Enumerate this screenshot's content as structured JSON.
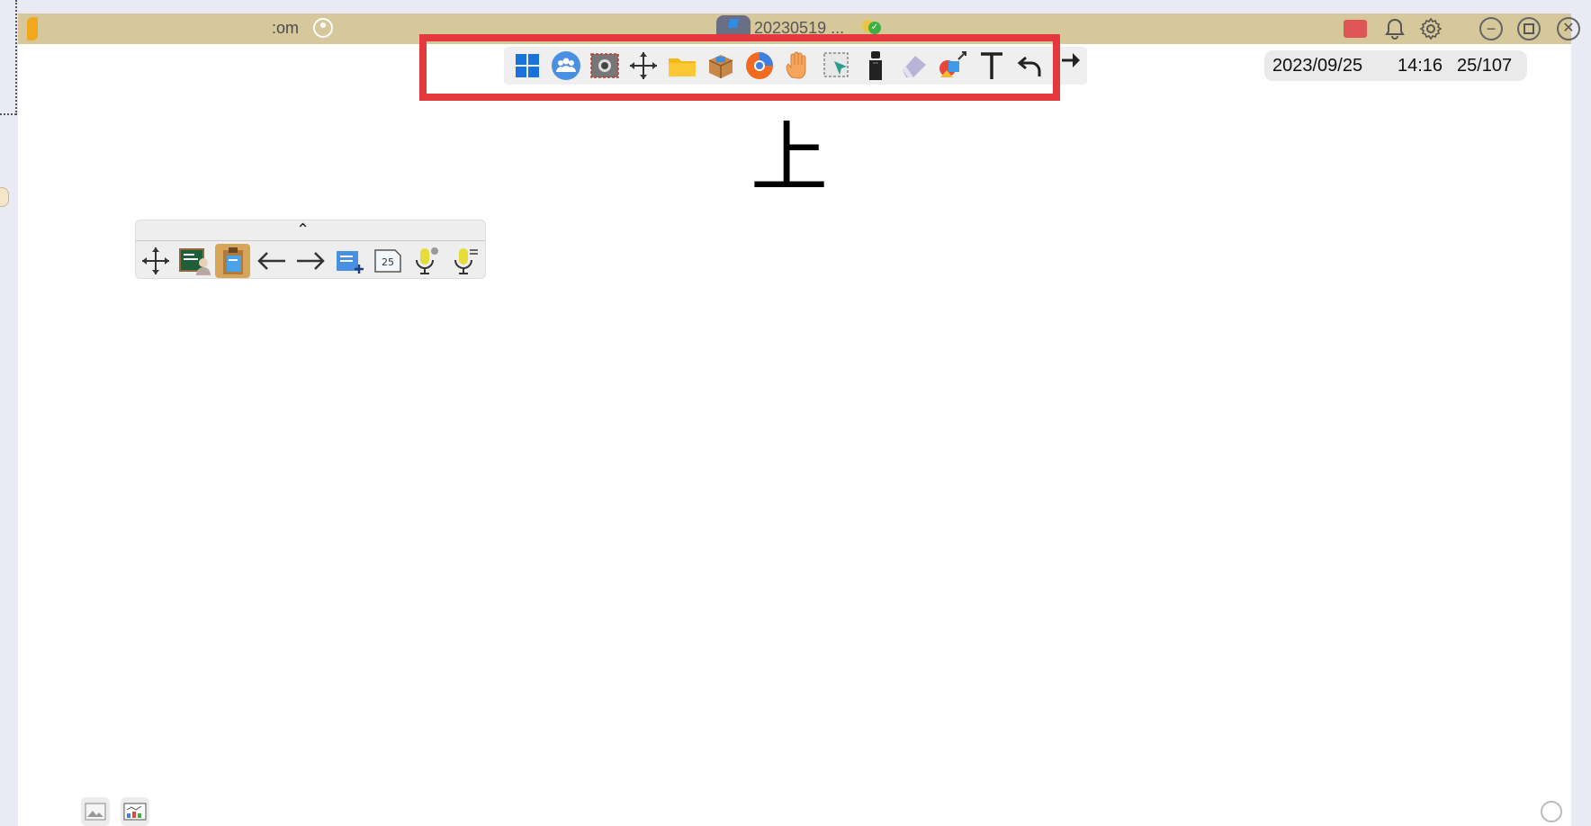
{
  "titlebar": {
    "account_text": ":om",
    "file_name": "20230519 ...",
    "icons": [
      "app-logo-icon",
      "user-icon",
      "file-icon",
      "sync-status-icon",
      "cast-icon",
      "bell-icon",
      "gear-icon",
      "minimize-icon",
      "maximize-icon",
      "close-icon"
    ]
  },
  "toolbar": {
    "tools": [
      "windows-icon",
      "group-icon",
      "screenshot-icon",
      "move-icon",
      "folder-icon",
      "box-icon",
      "browser-icon",
      "hand-icon",
      "select-icon",
      "marker-icon",
      "eraser-icon",
      "shape-icon",
      "text-icon",
      "undo-icon",
      "redo-icon"
    ],
    "highlight_color": "#e3393d"
  },
  "info": {
    "date": "2023/09/25",
    "time": "14:16",
    "page": "25/107"
  },
  "canvas": {
    "character": "上"
  },
  "floating_panel": {
    "collapse_glyph": "⌃",
    "tools": [
      "move-icon",
      "blackboard-icon",
      "clipboard-icon",
      "back-arrow-icon",
      "forward-arrow-icon",
      "add-page-icon",
      "page-number-icon",
      "mic-icon",
      "mic-settings-icon"
    ],
    "page_number": "25"
  },
  "colors": {
    "titlebar": "#d6c89a",
    "background": "#e9ebf4",
    "active_tool": "#d7a45a"
  }
}
